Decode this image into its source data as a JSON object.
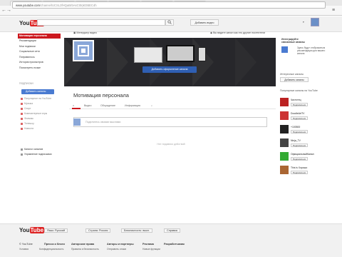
{
  "browser": {
    "tabs": [
      "Документы Google",
      "Отчетный канал Google",
      "Отчетные канал Google",
      "YouTube",
      "Создать новый канал",
      "Мотивация персонала"
    ],
    "url_host": "www.youtube.com",
    "url_rest": "/channel/UCSL3fHQaBrbAsCt0rjKDBEC4h"
  },
  "header": {
    "logo_you": "You",
    "logo_tube": "Tube",
    "search_icon": "search-icon",
    "add_video": "Добавить видео",
    "bell": "▾"
  },
  "sidebar": {
    "items": [
      "Мотивация персонала",
      "Рекомендации",
      "Мои подписки",
      "Социальные сети",
      "Понравилось",
      "История просмотров",
      "Посмотреть позже"
    ],
    "subs_head": "ПОДПИСКИ",
    "subscribe_btn": "Добавить каналы",
    "sub_items": [
      "Популярное на YouTube",
      "Музыка",
      "Спорт",
      "Компьютерные игры",
      "Фильмы",
      "Телешоу",
      "Новости"
    ],
    "browse": "Каталог каналов",
    "manage": "Управление подписками"
  },
  "main": {
    "video_manager": "Менеджер видео",
    "view_as": "Вы видите канал как его другие посетители",
    "add_art": "Добавить оформление канала",
    "channel_title": "Мотивация персонала",
    "tabs": [
      "Главная",
      "Видео",
      "Обсуждение",
      "Информация"
    ],
    "post_placeholder": "Поделитесь своими мыслями",
    "no_activity": "Нет недавних действий"
  },
  "right": {
    "promo": "Интегрируйте связанные каналы",
    "promo_text": "Здесь будут отображаться рекомендации для вашего канала",
    "related_head": "Интересные каналы",
    "add_channels": "Добавить каналы",
    "popular_head": "Популярные каналы на YouTube",
    "recs": [
      {
        "name": "Чистотец",
        "color": "#b22"
      },
      {
        "name": "DoodleArtTV",
        "color": "#c33"
      },
      {
        "name": "+100500",
        "color": "#222"
      },
      {
        "name": "Ninja_TV",
        "color": "#444"
      },
      {
        "name": "ОфициальныйКанал",
        "color": "#3a3"
      },
      {
        "name": "This is Хорошо",
        "color": "#a63"
      }
    ],
    "subscribe": "Подписаться"
  },
  "footer": {
    "logo_you": "You",
    "logo_tube": "Tube",
    "language": "Язык: Русский",
    "country": "Страна: Россия",
    "safety": "Безопасность: выкл.",
    "help": "Справка",
    "links": [
      "© YouTube",
      "Пресса и блоги",
      "Авторские права",
      "Авторы и партнеры",
      "Реклама",
      "Разработчикам"
    ],
    "links2": [
      "Условия",
      "Конфиденциальность",
      "Правила и безопасность",
      "Отправить отзыв",
      "Новые функции"
    ]
  }
}
